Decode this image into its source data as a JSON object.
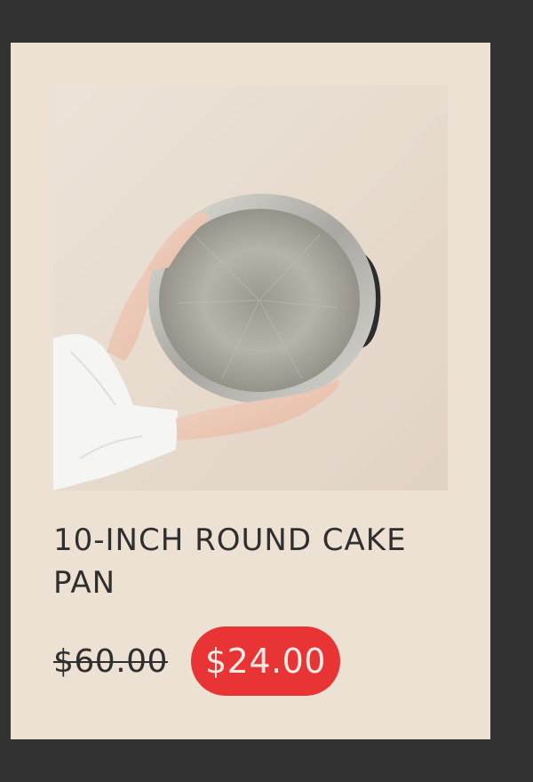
{
  "product": {
    "image_alt": "Hands holding a stainless steel round cake pan",
    "title": "10-Inch Round Cake Pan",
    "price_original": "$60.00",
    "price_sale": "$24.00"
  },
  "colors": {
    "page_background": "#323232",
    "card_background": "#ede1d3",
    "sale_badge": "#e83434",
    "text": "#2f2f2f"
  }
}
